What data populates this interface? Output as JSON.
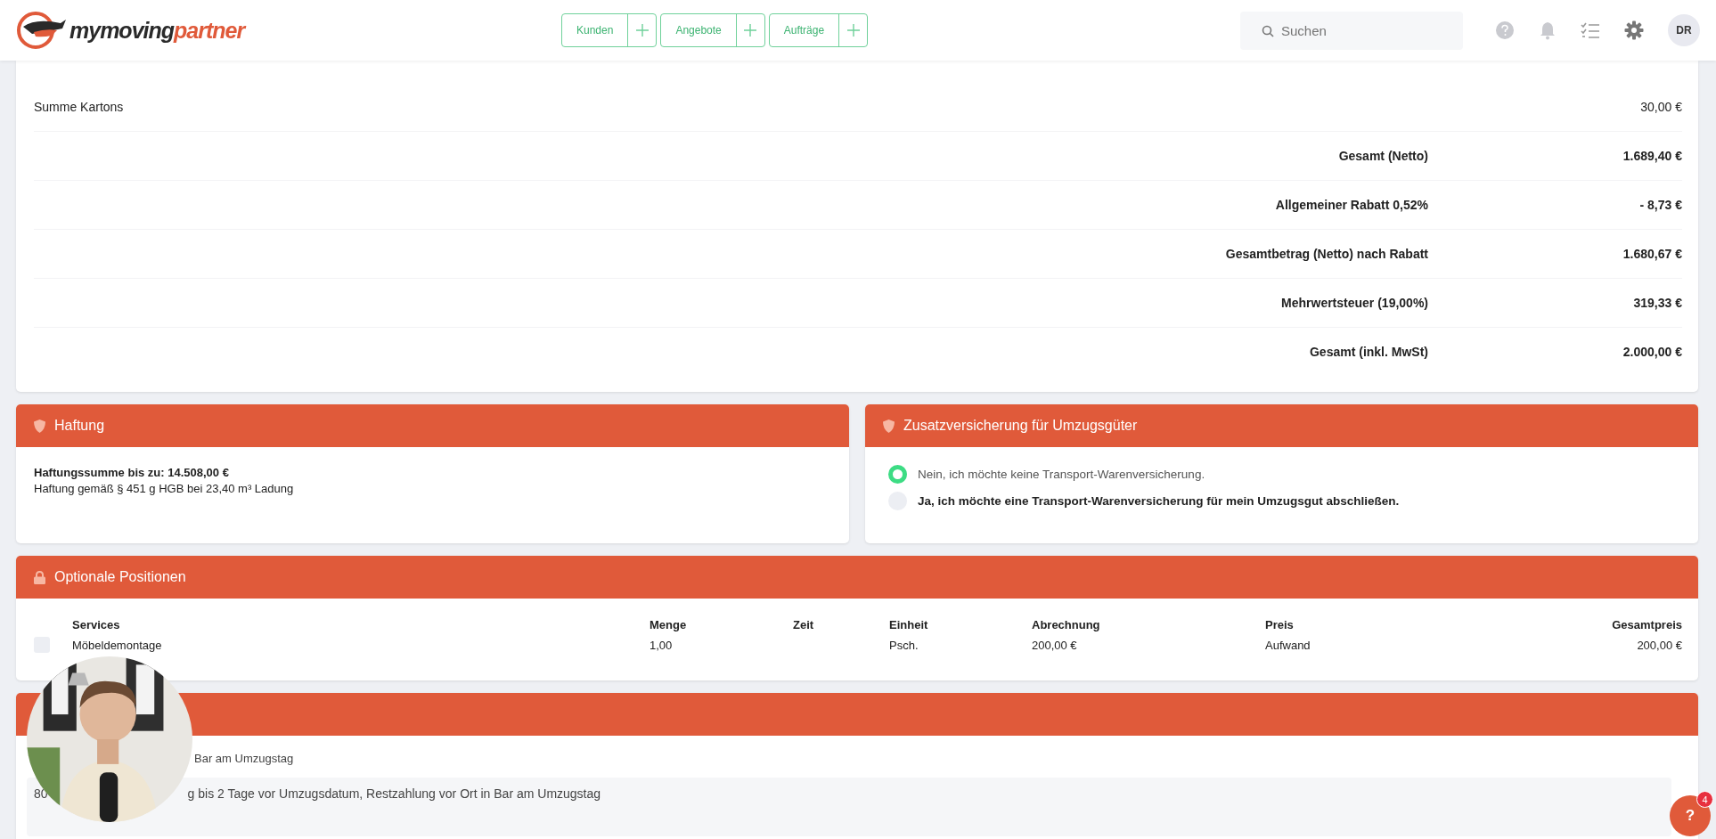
{
  "header": {
    "logo": {
      "text_dark": "mymoving",
      "text_accent": "partner"
    },
    "nav": [
      {
        "label": "Kunden"
      },
      {
        "label": "Angebote"
      },
      {
        "label": "Aufträge"
      }
    ],
    "search": {
      "placeholder": "Suchen"
    },
    "avatar": "DR"
  },
  "totals": [
    {
      "kind": "plain",
      "label": "Summe Kartons",
      "value": "30,00 €"
    },
    {
      "kind": "sum",
      "label": "Gesamt (Netto)",
      "value": "1.689,40 €"
    },
    {
      "kind": "sum",
      "label": "Allgemeiner Rabatt 0,52%",
      "value": "- 8,73 €"
    },
    {
      "kind": "sum",
      "label": "Gesamtbetrag (Netto) nach Rabatt",
      "value": "1.680,67 €"
    },
    {
      "kind": "sum",
      "label": "Mehrwertsteuer (19,00%)",
      "value": "319,33 €"
    },
    {
      "kind": "sum",
      "label": "Gesamt (inkl. MwSt)",
      "value": "2.000,00 €"
    }
  ],
  "liability": {
    "title": "Haftung",
    "sum": "Haftungssumme bis zu: 14.508,00 €",
    "note": "Haftung gemäß § 451 g HGB bei 23,40 m³ Ladung"
  },
  "insurance": {
    "title": "Zusatzversicherung für Umzugsgüter",
    "options": [
      {
        "label": "Nein, ich möchte keine Transport-Warenversicherung.",
        "selected": true
      },
      {
        "label": "Ja, ich möchte eine Transport-Warenversicherung für mein Umzugsgut abschließen.",
        "selected": false
      }
    ]
  },
  "optional": {
    "title": "Optionale Positionen",
    "columns": [
      "Services",
      "Menge",
      "Zeit",
      "Einheit",
      "Abrechnung",
      "Preis",
      "Gesamtpreis"
    ],
    "rows": [
      {
        "checked": false,
        "cells": [
          "Möbeldemontage",
          "1,00",
          "",
          "Psch.",
          "200,00 €",
          "Aufwand",
          "200,00 €"
        ]
      }
    ]
  },
  "payment": {
    "label_visible": "Bar am Umzugstag",
    "text_start": "80",
    "text_end": "g bis 2 Tage vor Umzugsdatum, Restzahlung vor Ort in Bar am Umzugstag"
  },
  "help": {
    "badge": "4",
    "label": "?"
  }
}
